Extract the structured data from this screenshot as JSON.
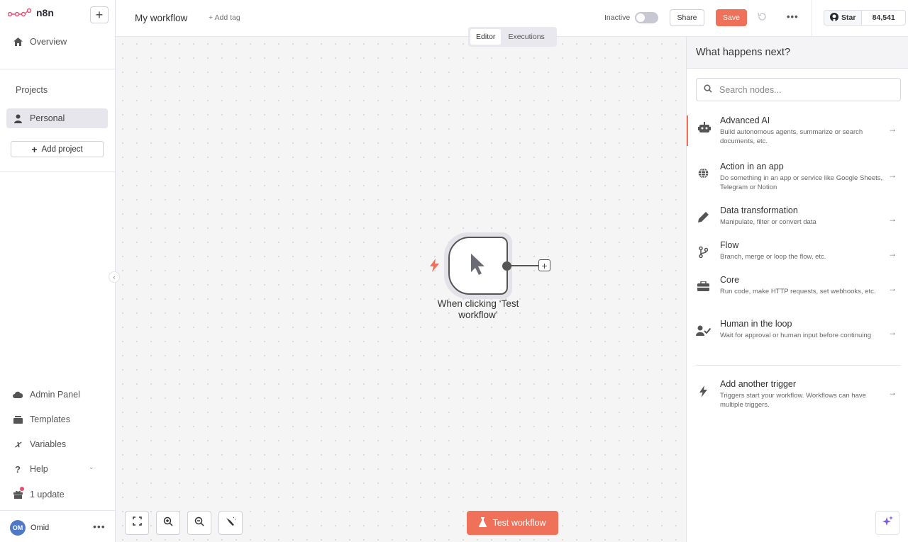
{
  "app": {
    "logo_text": "n8n"
  },
  "sidebar": {
    "overview": "Overview",
    "projects_label": "Projects",
    "personal": "Personal",
    "add_project": "Add project",
    "bottom": {
      "admin_panel": "Admin Panel",
      "templates": "Templates",
      "variables": "Variables",
      "help": "Help",
      "updates": "1 update"
    },
    "user": {
      "initials": "OM",
      "name": "Omid"
    }
  },
  "header": {
    "workflow_name": "My workflow",
    "add_tag": "+ Add tag",
    "status_label": "Inactive",
    "share": "Share",
    "save": "Save",
    "github_star": "Star",
    "github_count": "84,541"
  },
  "canvas": {
    "tabs": [
      {
        "label": "Editor",
        "active": true
      },
      {
        "label": "Executions",
        "active": false
      }
    ],
    "node_label": "When clicking ‘Test workflow’",
    "test_button": "Test workflow"
  },
  "panel": {
    "title": "What happens next?",
    "search_placeholder": "Search nodes...",
    "categories": [
      {
        "title": "Advanced AI",
        "desc": "Build autonomous agents, summarize or search documents, etc.",
        "icon": "robot-icon"
      },
      {
        "title": "Action in an app",
        "desc": "Do something in an app or service like Google Sheets, Telegram or Notion",
        "icon": "globe-icon"
      },
      {
        "title": "Data transformation",
        "desc": "Manipulate, filter or convert data",
        "icon": "pen-icon"
      },
      {
        "title": "Flow",
        "desc": "Branch, merge or loop the flow, etc.",
        "icon": "branch-icon"
      },
      {
        "title": "Core",
        "desc": "Run code, make HTTP requests, set webhooks, etc.",
        "icon": "toolbox-icon"
      },
      {
        "title": "Human in the loop",
        "desc": "Wait for approval or human input before continuing",
        "icon": "user-check-icon"
      }
    ],
    "trigger": {
      "title": "Add another trigger",
      "desc": "Triggers start your workflow. Workflows can have multiple triggers.",
      "icon": "bolt-icon"
    }
  },
  "colors": {
    "accent": "#ef7159",
    "node_border": "#555555",
    "sidebar_active": "#e6e6ec"
  }
}
